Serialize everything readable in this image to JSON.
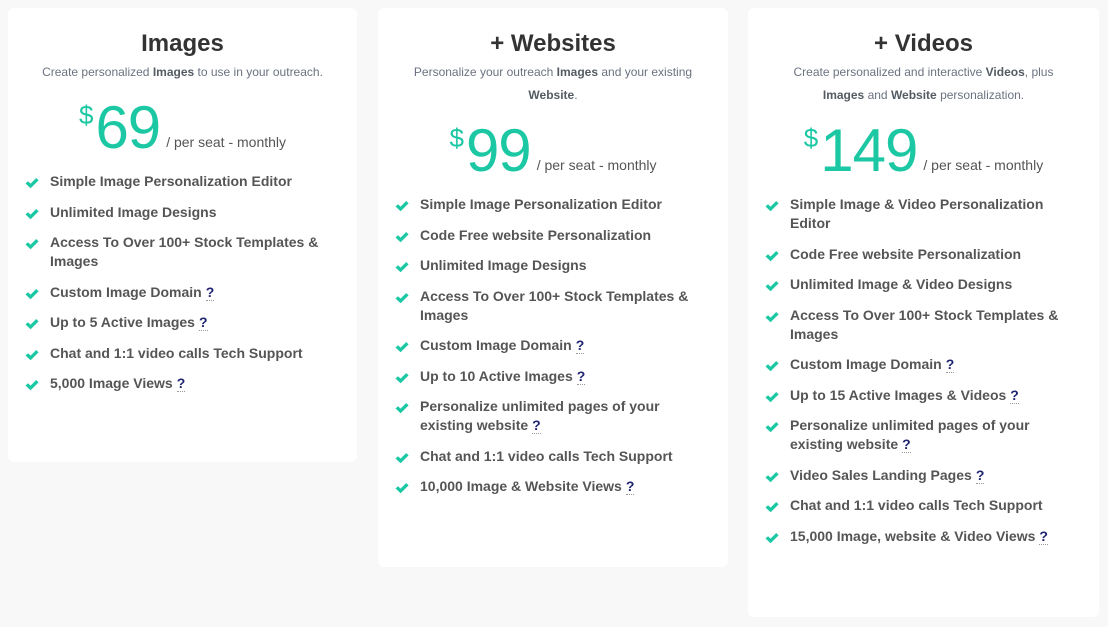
{
  "accent_color": "#1cc8a4",
  "plans": [
    {
      "title": "Images",
      "description": [
        {
          "text": "Create personalized ",
          "bold": false
        },
        {
          "text": "Images",
          "bold": true
        },
        {
          "text": " to use in your outreach.",
          "bold": false
        }
      ],
      "currency": "$",
      "price": "69",
      "period": "/ per seat - monthly",
      "features": [
        {
          "text": "Simple Image Personalization Editor",
          "help": false
        },
        {
          "text": "Unlimited Image Designs",
          "help": false
        },
        {
          "text": "Access To Over 100+ Stock Templates & Images",
          "help": false
        },
        {
          "text": "Custom Image Domain",
          "help": true
        },
        {
          "text": "Up to 5 Active Images",
          "help": true
        },
        {
          "text": "Chat and 1:1 video calls Tech Support",
          "help": false
        },
        {
          "text": "5,000 Image Views",
          "help": true
        }
      ]
    },
    {
      "title": "+ Websites",
      "description": [
        {
          "text": "Personalize your outreach ",
          "bold": false
        },
        {
          "text": "Images",
          "bold": true
        },
        {
          "text": " and your existing ",
          "bold": false
        },
        {
          "text": "Website",
          "bold": true
        },
        {
          "text": ".",
          "bold": false
        }
      ],
      "currency": "$",
      "price": "99",
      "period": "/ per seat - monthly",
      "features": [
        {
          "text": "Simple Image Personalization Editor",
          "help": false
        },
        {
          "text": "Code Free website Personalization",
          "help": false
        },
        {
          "text": "Unlimited Image Designs",
          "help": false
        },
        {
          "text": "Access To Over 100+ Stock Templates & Images",
          "help": false
        },
        {
          "text": "Custom Image Domain",
          "help": true
        },
        {
          "text": "Up to 10 Active Images",
          "help": true
        },
        {
          "text": "Personalize unlimited pages of your existing website",
          "help": true
        },
        {
          "text": "Chat and 1:1 video calls Tech Support",
          "help": false
        },
        {
          "text": "10,000 Image & Website Views",
          "help": true
        }
      ]
    },
    {
      "title": "+ Videos",
      "description": [
        {
          "text": "Create personalized and interactive ",
          "bold": false
        },
        {
          "text": "Videos",
          "bold": true
        },
        {
          "text": ", plus ",
          "bold": false
        },
        {
          "text": "Images",
          "bold": true
        },
        {
          "text": " and ",
          "bold": false
        },
        {
          "text": "Website",
          "bold": true
        },
        {
          "text": " personalization.",
          "bold": false
        }
      ],
      "currency": "$",
      "price": "149",
      "period": "/ per seat - monthly",
      "features": [
        {
          "text": "Simple Image & Video Personalization Editor",
          "help": false
        },
        {
          "text": "Code Free website Personalization",
          "help": false
        },
        {
          "text": "Unlimited Image & Video Designs",
          "help": false
        },
        {
          "text": "Access To Over 100+ Stock Templates & Images",
          "help": false
        },
        {
          "text": "Custom Image Domain",
          "help": true
        },
        {
          "text": "Up to 15 Active Images & Videos",
          "help": true
        },
        {
          "text": "Personalize unlimited pages of your existing website",
          "help": true
        },
        {
          "text": "Video Sales Landing Pages",
          "help": true
        },
        {
          "text": "Chat and 1:1 video calls Tech Support",
          "help": false
        },
        {
          "text": "15,000 Image, website & Video Views",
          "help": true
        }
      ]
    }
  ],
  "help_glyph": "?",
  "check_icon": "check-icon"
}
